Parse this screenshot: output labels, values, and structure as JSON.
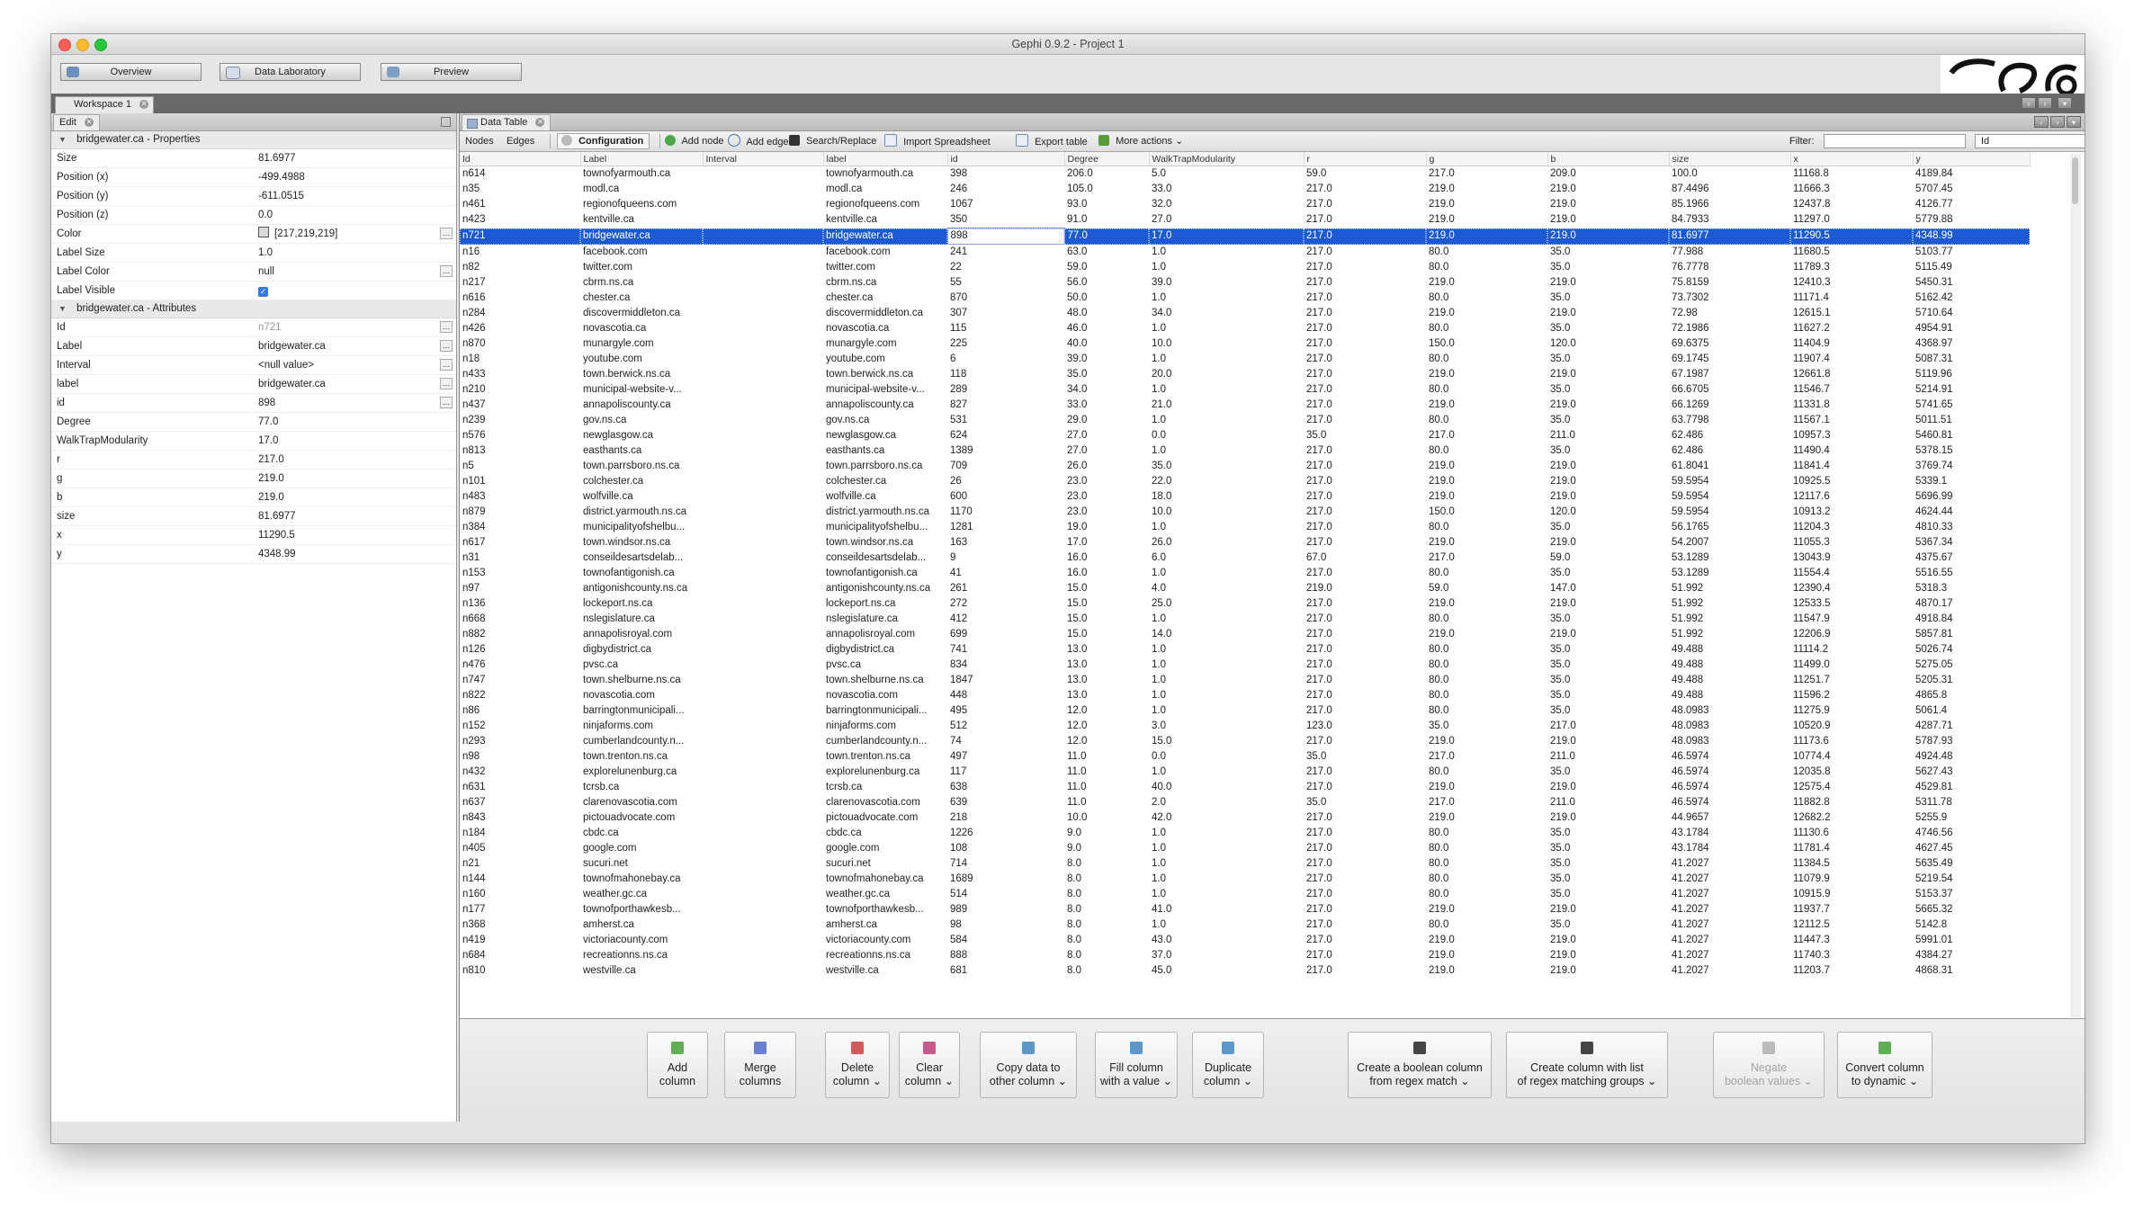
{
  "window": {
    "title": "Gephi 0.9.2 - Project 1"
  },
  "modes": [
    "Overview",
    "Data Laboratory",
    "Preview"
  ],
  "workspace_tab": "Workspace 1",
  "left_panel": {
    "tab": "Edit",
    "properties_header": "bridgewater.ca - Properties",
    "properties": [
      {
        "k": "Size",
        "v": "81.6977"
      },
      {
        "k": "Position (x)",
        "v": "-499.4988"
      },
      {
        "k": "Position (y)",
        "v": "-611.0515"
      },
      {
        "k": "Position (z)",
        "v": "0.0"
      },
      {
        "k": "Color",
        "v": "[217,219,219]"
      },
      {
        "k": "Label Size",
        "v": "1.0"
      },
      {
        "k": "Label Color",
        "v": "null"
      },
      {
        "k": "Label Visible",
        "v": ""
      }
    ],
    "attributes_header": "bridgewater.ca - Attributes",
    "attributes": [
      {
        "k": "Id",
        "v": "n721"
      },
      {
        "k": "Label",
        "v": "bridgewater.ca"
      },
      {
        "k": "Interval",
        "v": "<null value>"
      },
      {
        "k": "label",
        "v": "bridgewater.ca"
      },
      {
        "k": "id",
        "v": "898"
      },
      {
        "k": "Degree",
        "v": "77.0"
      },
      {
        "k": "WalkTrapModularity",
        "v": "17.0"
      },
      {
        "k": "r",
        "v": "217.0"
      },
      {
        "k": "g",
        "v": "219.0"
      },
      {
        "k": "b",
        "v": "219.0"
      },
      {
        "k": "size",
        "v": "81.6977"
      },
      {
        "k": "x",
        "v": "11290.5"
      },
      {
        "k": "y",
        "v": "4348.99"
      }
    ]
  },
  "data_table": {
    "tab": "Data Table",
    "toolbar": {
      "nodes": "Nodes",
      "edges": "Edges",
      "configuration": "Configuration",
      "add_node": "Add node",
      "add_edge": "Add edge",
      "search_replace": "Search/Replace",
      "import_spreadsheet": "Import Spreadsheet",
      "export_table": "Export table",
      "more_actions": "More actions",
      "filter_label": "Filter:",
      "filter_column": "Id"
    },
    "columns": [
      "Id",
      "Label",
      "Interval",
      "label",
      "id",
      "Degree",
      "WalkTrapModularity",
      "r",
      "g",
      "b",
      "size",
      "x",
      "y"
    ],
    "rows": [
      [
        "n614",
        "townofyarmouth.ca",
        "",
        "townofyarmouth.ca",
        "398",
        "206.0",
        "5.0",
        "59.0",
        "217.0",
        "209.0",
        "100.0",
        "11168.8",
        "4189.84"
      ],
      [
        "n35",
        "modl.ca",
        "",
        "modl.ca",
        "246",
        "105.0",
        "33.0",
        "217.0",
        "219.0",
        "219.0",
        "87.4496",
        "11666.3",
        "5707.45"
      ],
      [
        "n461",
        "regionofqueens.com",
        "",
        "regionofqueens.com",
        "1067",
        "93.0",
        "32.0",
        "217.0",
        "219.0",
        "219.0",
        "85.1966",
        "12437.8",
        "4126.77"
      ],
      [
        "n423",
        "kentville.ca",
        "",
        "kentville.ca",
        "350",
        "91.0",
        "27.0",
        "217.0",
        "219.0",
        "219.0",
        "84.7933",
        "11297.0",
        "5779.88"
      ],
      [
        "n721",
        "bridgewater.ca",
        "",
        "bridgewater.ca",
        "898",
        "77.0",
        "17.0",
        "217.0",
        "219.0",
        "219.0",
        "81.6977",
        "11290.5",
        "4348.99"
      ],
      [
        "n16",
        "facebook.com",
        "",
        "facebook.com",
        "241",
        "63.0",
        "1.0",
        "217.0",
        "80.0",
        "35.0",
        "77.988",
        "11680.5",
        "5103.77"
      ],
      [
        "n82",
        "twitter.com",
        "",
        "twitter.com",
        "22",
        "59.0",
        "1.0",
        "217.0",
        "80.0",
        "35.0",
        "76.7778",
        "11789.3",
        "5115.49"
      ],
      [
        "n217",
        "cbrm.ns.ca",
        "",
        "cbrm.ns.ca",
        "55",
        "56.0",
        "39.0",
        "217.0",
        "219.0",
        "219.0",
        "75.8159",
        "12410.3",
        "5450.31"
      ],
      [
        "n616",
        "chester.ca",
        "",
        "chester.ca",
        "870",
        "50.0",
        "1.0",
        "217.0",
        "80.0",
        "35.0",
        "73.7302",
        "11171.4",
        "5162.42"
      ],
      [
        "n284",
        "discovermiddleton.ca",
        "",
        "discovermiddleton.ca",
        "307",
        "48.0",
        "34.0",
        "217.0",
        "219.0",
        "219.0",
        "72.98",
        "12615.1",
        "5710.64"
      ],
      [
        "n426",
        "novascotia.ca",
        "",
        "novascotia.ca",
        "115",
        "46.0",
        "1.0",
        "217.0",
        "80.0",
        "35.0",
        "72.1986",
        "11627.2",
        "4954.91"
      ],
      [
        "n870",
        "munargyle.com",
        "",
        "munargyle.com",
        "225",
        "40.0",
        "10.0",
        "217.0",
        "150.0",
        "120.0",
        "69.6375",
        "11404.9",
        "4368.97"
      ],
      [
        "n18",
        "youtube.com",
        "",
        "youtube.com",
        "6",
        "39.0",
        "1.0",
        "217.0",
        "80.0",
        "35.0",
        "69.1745",
        "11907.4",
        "5087.31"
      ],
      [
        "n433",
        "town.berwick.ns.ca",
        "",
        "town.berwick.ns.ca",
        "118",
        "35.0",
        "20.0",
        "217.0",
        "219.0",
        "219.0",
        "67.1987",
        "12661.8",
        "5119.96"
      ],
      [
        "n210",
        "municipal-website-v...",
        "",
        "municipal-website-v...",
        "289",
        "34.0",
        "1.0",
        "217.0",
        "80.0",
        "35.0",
        "66.6705",
        "11546.7",
        "5214.91"
      ],
      [
        "n437",
        "annapoliscounty.ca",
        "",
        "annapoliscounty.ca",
        "827",
        "33.0",
        "21.0",
        "217.0",
        "219.0",
        "219.0",
        "66.1269",
        "11331.8",
        "5741.65"
      ],
      [
        "n239",
        "gov.ns.ca",
        "",
        "gov.ns.ca",
        "531",
        "29.0",
        "1.0",
        "217.0",
        "80.0",
        "35.0",
        "63.7798",
        "11567.1",
        "5011.51"
      ],
      [
        "n576",
        "newglasgow.ca",
        "",
        "newglasgow.ca",
        "624",
        "27.0",
        "0.0",
        "35.0",
        "217.0",
        "211.0",
        "62.486",
        "10957.3",
        "5460.81"
      ],
      [
        "n813",
        "easthants.ca",
        "",
        "easthants.ca",
        "1389",
        "27.0",
        "1.0",
        "217.0",
        "80.0",
        "35.0",
        "62.486",
        "11490.4",
        "5378.15"
      ],
      [
        "n5",
        "town.parrsboro.ns.ca",
        "",
        "town.parrsboro.ns.ca",
        "709",
        "26.0",
        "35.0",
        "217.0",
        "219.0",
        "219.0",
        "61.8041",
        "11841.4",
        "3769.74"
      ],
      [
        "n101",
        "colchester.ca",
        "",
        "colchester.ca",
        "26",
        "23.0",
        "22.0",
        "217.0",
        "219.0",
        "219.0",
        "59.5954",
        "10925.5",
        "5339.1"
      ],
      [
        "n483",
        "wolfville.ca",
        "",
        "wolfville.ca",
        "600",
        "23.0",
        "18.0",
        "217.0",
        "219.0",
        "219.0",
        "59.5954",
        "12117.6",
        "5696.99"
      ],
      [
        "n879",
        "district.yarmouth.ns.ca",
        "",
        "district.yarmouth.ns.ca",
        "1170",
        "23.0",
        "10.0",
        "217.0",
        "150.0",
        "120.0",
        "59.5954",
        "10913.2",
        "4624.44"
      ],
      [
        "n384",
        "municipalityofshelbu...",
        "",
        "municipalityofshelbu...",
        "1281",
        "19.0",
        "1.0",
        "217.0",
        "80.0",
        "35.0",
        "56.1765",
        "11204.3",
        "4810.33"
      ],
      [
        "n617",
        "town.windsor.ns.ca",
        "",
        "town.windsor.ns.ca",
        "163",
        "17.0",
        "26.0",
        "217.0",
        "219.0",
        "219.0",
        "54.2007",
        "11055.3",
        "5367.34"
      ],
      [
        "n31",
        "conseildesartsdelab...",
        "",
        "conseildesartsdelab...",
        "9",
        "16.0",
        "6.0",
        "67.0",
        "217.0",
        "59.0",
        "53.1289",
        "13043.9",
        "4375.67"
      ],
      [
        "n153",
        "townofantigonish.ca",
        "",
        "townofantigonish.ca",
        "41",
        "16.0",
        "1.0",
        "217.0",
        "80.0",
        "35.0",
        "53.1289",
        "11554.4",
        "5516.55"
      ],
      [
        "n97",
        "antigonishcounty.ns.ca",
        "",
        "antigonishcounty.ns.ca",
        "261",
        "15.0",
        "4.0",
        "219.0",
        "59.0",
        "147.0",
        "51.992",
        "12390.4",
        "5318.3"
      ],
      [
        "n136",
        "lockeport.ns.ca",
        "",
        "lockeport.ns.ca",
        "272",
        "15.0",
        "25.0",
        "217.0",
        "219.0",
        "219.0",
        "51.992",
        "12533.5",
        "4870.17"
      ],
      [
        "n668",
        "nslegislature.ca",
        "",
        "nslegislature.ca",
        "412",
        "15.0",
        "1.0",
        "217.0",
        "80.0",
        "35.0",
        "51.992",
        "11547.9",
        "4918.84"
      ],
      [
        "n882",
        "annapolisroyal.com",
        "",
        "annapolisroyal.com",
        "699",
        "15.0",
        "14.0",
        "217.0",
        "219.0",
        "219.0",
        "51.992",
        "12206.9",
        "5857.81"
      ],
      [
        "n126",
        "digbydistrict.ca",
        "",
        "digbydistrict.ca",
        "741",
        "13.0",
        "1.0",
        "217.0",
        "80.0",
        "35.0",
        "49.488",
        "11114.2",
        "5026.74"
      ],
      [
        "n476",
        "pvsc.ca",
        "",
        "pvsc.ca",
        "834",
        "13.0",
        "1.0",
        "217.0",
        "80.0",
        "35.0",
        "49.488",
        "11499.0",
        "5275.05"
      ],
      [
        "n747",
        "town.shelburne.ns.ca",
        "",
        "town.shelburne.ns.ca",
        "1847",
        "13.0",
        "1.0",
        "217.0",
        "80.0",
        "35.0",
        "49.488",
        "11251.7",
        "5205.31"
      ],
      [
        "n822",
        "novascotia.com",
        "",
        "novascotia.com",
        "448",
        "13.0",
        "1.0",
        "217.0",
        "80.0",
        "35.0",
        "49.488",
        "11596.2",
        "4865.8"
      ],
      [
        "n86",
        "barringtonmunicipali...",
        "",
        "barringtonmunicipali...",
        "495",
        "12.0",
        "1.0",
        "217.0",
        "80.0",
        "35.0",
        "48.0983",
        "11275.9",
        "5061.4"
      ],
      [
        "n152",
        "ninjaforms.com",
        "",
        "ninjaforms.com",
        "512",
        "12.0",
        "3.0",
        "123.0",
        "35.0",
        "217.0",
        "48.0983",
        "10520.9",
        "4287.71"
      ],
      [
        "n293",
        "cumberlandcounty.n...",
        "",
        "cumberlandcounty.n...",
        "74",
        "12.0",
        "15.0",
        "217.0",
        "219.0",
        "219.0",
        "48.0983",
        "11173.6",
        "5787.93"
      ],
      [
        "n98",
        "town.trenton.ns.ca",
        "",
        "town.trenton.ns.ca",
        "497",
        "11.0",
        "0.0",
        "35.0",
        "217.0",
        "211.0",
        "46.5974",
        "10774.4",
        "4924.48"
      ],
      [
        "n432",
        "explorelunenburg.ca",
        "",
        "explorelunenburg.ca",
        "117",
        "11.0",
        "1.0",
        "217.0",
        "80.0",
        "35.0",
        "46.5974",
        "12035.8",
        "5627.43"
      ],
      [
        "n631",
        "tcrsb.ca",
        "",
        "tcrsb.ca",
        "638",
        "11.0",
        "40.0",
        "217.0",
        "219.0",
        "219.0",
        "46.5974",
        "12575.4",
        "4529.81"
      ],
      [
        "n637",
        "clarenovascotia.com",
        "",
        "clarenovascotia.com",
        "639",
        "11.0",
        "2.0",
        "35.0",
        "217.0",
        "211.0",
        "46.5974",
        "11882.8",
        "5311.78"
      ],
      [
        "n843",
        "pictouadvocate.com",
        "",
        "pictouadvocate.com",
        "218",
        "10.0",
        "42.0",
        "217.0",
        "219.0",
        "219.0",
        "44.9657",
        "12682.2",
        "5255.9"
      ],
      [
        "n184",
        "cbdc.ca",
        "",
        "cbdc.ca",
        "1226",
        "9.0",
        "1.0",
        "217.0",
        "80.0",
        "35.0",
        "43.1784",
        "11130.6",
        "4746.56"
      ],
      [
        "n405",
        "google.com",
        "",
        "google.com",
        "108",
        "9.0",
        "1.0",
        "217.0",
        "80.0",
        "35.0",
        "43.1784",
        "11781.4",
        "4627.45"
      ],
      [
        "n21",
        "sucuri.net",
        "",
        "sucuri.net",
        "714",
        "8.0",
        "1.0",
        "217.0",
        "80.0",
        "35.0",
        "41.2027",
        "11384.5",
        "5635.49"
      ],
      [
        "n144",
        "townofmahonebay.ca",
        "",
        "townofmahonebay.ca",
        "1689",
        "8.0",
        "1.0",
        "217.0",
        "80.0",
        "35.0",
        "41.2027",
        "11079.9",
        "5219.54"
      ],
      [
        "n160",
        "weather.gc.ca",
        "",
        "weather.gc.ca",
        "514",
        "8.0",
        "1.0",
        "217.0",
        "80.0",
        "35.0",
        "41.2027",
        "10915.9",
        "5153.37"
      ],
      [
        "n177",
        "townofporthawkesb...",
        "",
        "townofporthawkesb...",
        "989",
        "8.0",
        "41.0",
        "217.0",
        "219.0",
        "219.0",
        "41.2027",
        "11937.7",
        "5665.32"
      ],
      [
        "n368",
        "amherst.ca",
        "",
        "amherst.ca",
        "98",
        "8.0",
        "1.0",
        "217.0",
        "80.0",
        "35.0",
        "41.2027",
        "12112.5",
        "5142.8"
      ],
      [
        "n419",
        "victoriacounty.com",
        "",
        "victoriacounty.com",
        "584",
        "8.0",
        "43.0",
        "217.0",
        "219.0",
        "219.0",
        "41.2027",
        "11447.3",
        "5991.01"
      ],
      [
        "n684",
        "recreationns.ns.ca",
        "",
        "recreationns.ns.ca",
        "888",
        "8.0",
        "37.0",
        "217.0",
        "219.0",
        "219.0",
        "41.2027",
        "11740.3",
        "4384.27"
      ],
      [
        "n810",
        "westville.ca",
        "",
        "westville.ca",
        "681",
        "8.0",
        "45.0",
        "217.0",
        "219.0",
        "219.0",
        "41.2027",
        "11203.7",
        "4868.31"
      ]
    ],
    "selected_row": 4
  },
  "bottom_actions": [
    {
      "l1": "Add",
      "l2": "column",
      "enabled": true,
      "color": "#5fae54"
    },
    {
      "l1": "Merge",
      "l2": "columns",
      "enabled": true,
      "color": "#6a7fd0"
    },
    {
      "l1": "Delete",
      "l2": "column ⌄",
      "enabled": true,
      "color": "#d35a5a"
    },
    {
      "l1": "Clear",
      "l2": "column ⌄",
      "enabled": true,
      "color": "#c65b8a"
    },
    {
      "l1": "Copy data to",
      "l2": "other column ⌄",
      "enabled": true,
      "color": "#5c97c8"
    },
    {
      "l1": "Fill column",
      "l2": "with a value ⌄",
      "enabled": true,
      "color": "#5c97c8"
    },
    {
      "l1": "Duplicate",
      "l2": "column ⌄",
      "enabled": true,
      "color": "#5c97c8"
    },
    {
      "l1": "Create a boolean column",
      "l2": "from regex match ⌄",
      "enabled": true,
      "color": "#444444"
    },
    {
      "l1": "Create column with list",
      "l2": "of regex matching groups ⌄",
      "enabled": true,
      "color": "#444444"
    },
    {
      "l1": "Negate",
      "l2": "boolean values ⌄",
      "enabled": false,
      "color": "#bbbbbb"
    },
    {
      "l1": "Convert column",
      "l2": "to dynamic ⌄",
      "enabled": true,
      "color": "#5fae54"
    }
  ]
}
